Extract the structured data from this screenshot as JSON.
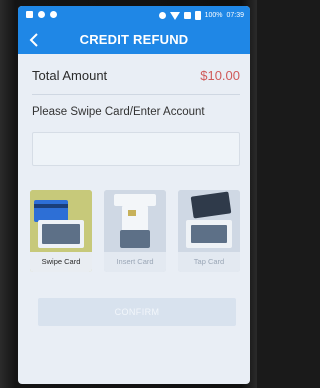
{
  "status": {
    "battery_text": "100%",
    "time": "07:39"
  },
  "header": {
    "title": "CREDIT REFUND"
  },
  "summary": {
    "total_label": "Total Amount",
    "total_amount": "$10.00"
  },
  "instruction": "Please Swipe Card/Enter Account",
  "account_input": {
    "value": "",
    "placeholder": ""
  },
  "options": [
    {
      "label": "Swipe Card",
      "selected": true
    },
    {
      "label": "Insert Card",
      "selected": false
    },
    {
      "label": "Tap Card",
      "selected": false
    }
  ],
  "confirm_label": "CONFIRM",
  "colors": {
    "primary": "#1f87e6",
    "amount": "#d05a5a",
    "selected": "#c7c97a"
  }
}
